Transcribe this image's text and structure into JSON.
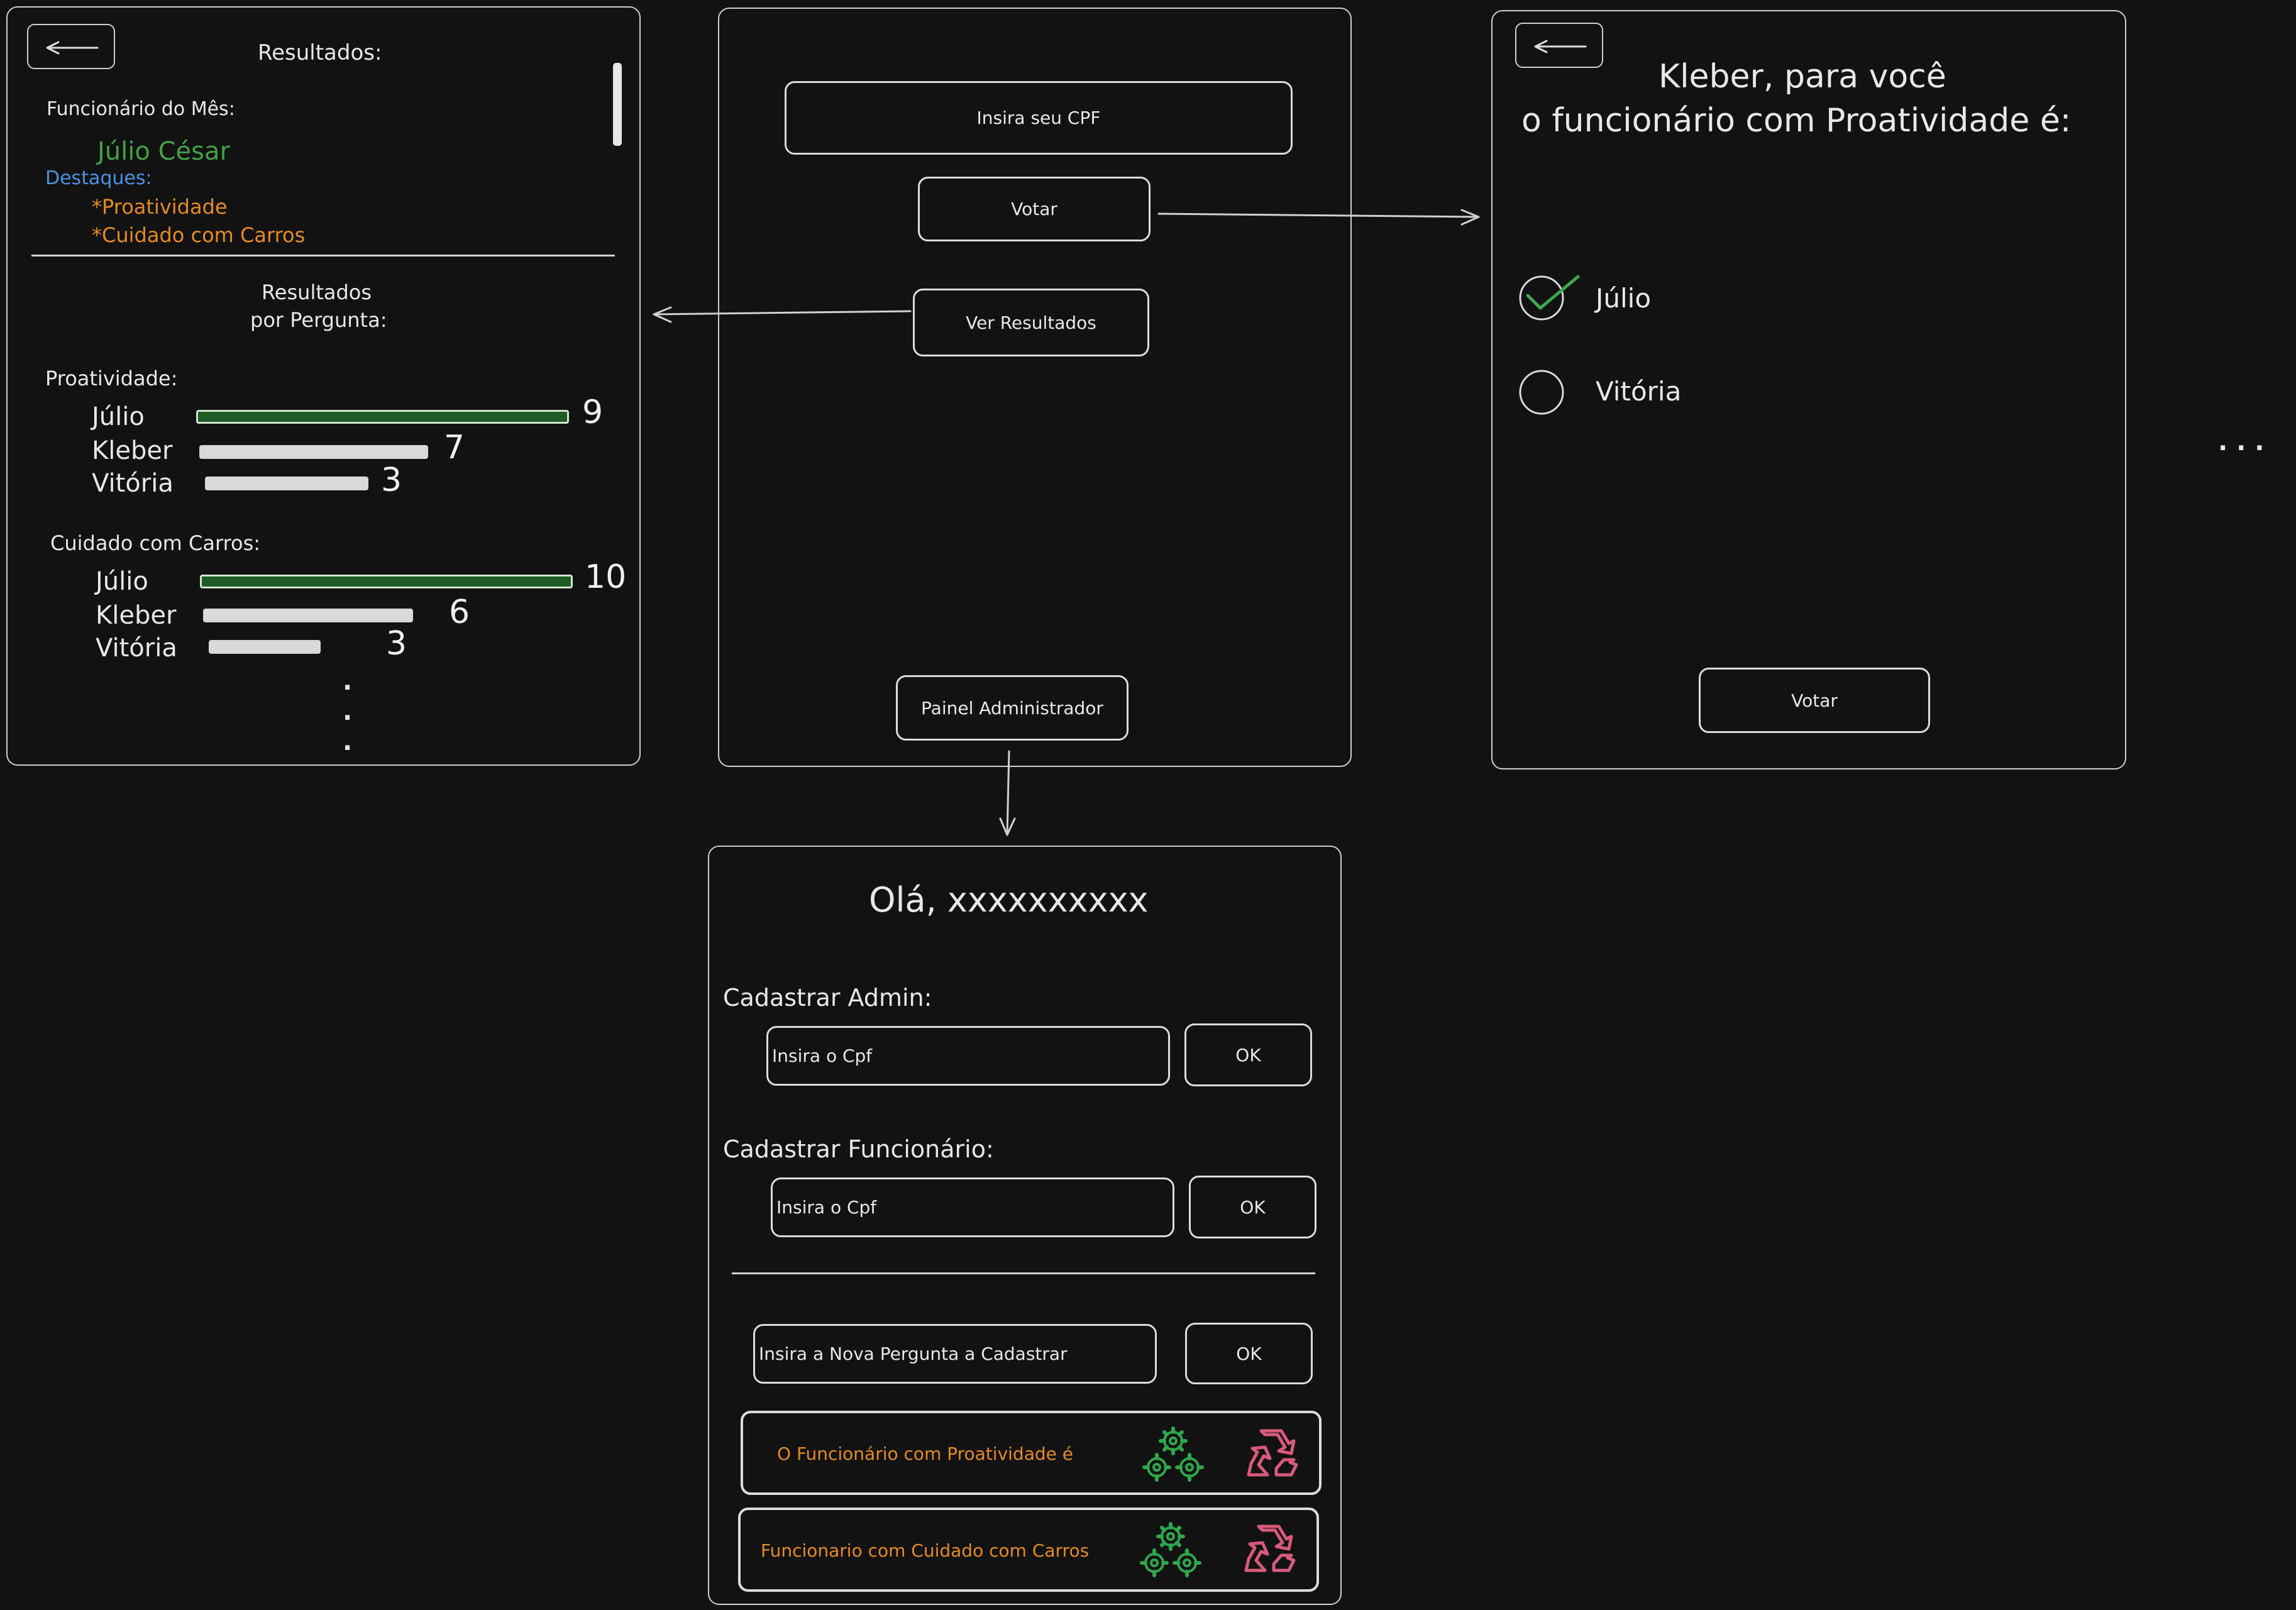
{
  "results_screen": {
    "title": "Resultados:",
    "employee_of_month_label": "Funcionário do Mês:",
    "employee_of_month_name": "Júlio César",
    "highlights_label": "Destaques:",
    "highlights": [
      "*Proatividade",
      "*Cuidado com Carros"
    ],
    "per_question_title_line1": "Resultados",
    "per_question_title_line2": "por Pergunta:",
    "ellipsis_vertical": ".\n.\n.",
    "questions": [
      {
        "label": "Proatividade:",
        "rows": [
          {
            "name": "Júlio",
            "value": "9"
          },
          {
            "name": "Kleber",
            "value": "7"
          },
          {
            "name": "Vitória",
            "value": "3"
          }
        ]
      },
      {
        "label": "Cuidado com Carros:",
        "rows": [
          {
            "name": "Júlio",
            "value": "10"
          },
          {
            "name": "Kleber",
            "value": "6"
          },
          {
            "name": "Vitória",
            "value": "3"
          }
        ]
      }
    ]
  },
  "home_screen": {
    "cpf_input": "Insira seu CPF",
    "vote_button": "Votar",
    "results_button": "Ver Resultados",
    "admin_button": "Painel Administrador"
  },
  "vote_screen": {
    "heading_line1": "Kleber, para você",
    "heading_line2": "o funcionário com Proatividade é:",
    "options": [
      {
        "label": "Júlio",
        "checked": true
      },
      {
        "label": "Vitória",
        "checked": false
      }
    ],
    "vote_button": "Votar",
    "more": ". . ."
  },
  "admin_screen": {
    "greeting": "Olá, xxxxxxxxxx",
    "register_admin_label": "Cadastrar Admin:",
    "register_admin_placeholder": "Insira o Cpf",
    "register_admin_ok": "OK",
    "register_employee_label": "Cadastrar Funcionário:",
    "register_employee_placeholder": "Insira o Cpf",
    "register_employee_ok": "OK",
    "new_question_placeholder": "Insira a Nova Pergunta a Cadastrar",
    "new_question_ok": "OK",
    "questions": [
      {
        "text": "O Funcionário com Proatividade é"
      },
      {
        "text": "Funcionario com Cuidado com Carros"
      }
    ]
  },
  "colors": {
    "background": "#121212",
    "accent_green": "#44a044",
    "accent_orange": "#e58a25",
    "accent_blue": "#4a8fe0",
    "bar_green": "#1e5b25",
    "bar_white": "#d9d9d9",
    "recycle_pink": "#d85a7a"
  },
  "icons": [
    "back-arrow-icon",
    "check-icon",
    "gears-icon",
    "recycle-icon",
    "arrow-icon"
  ]
}
